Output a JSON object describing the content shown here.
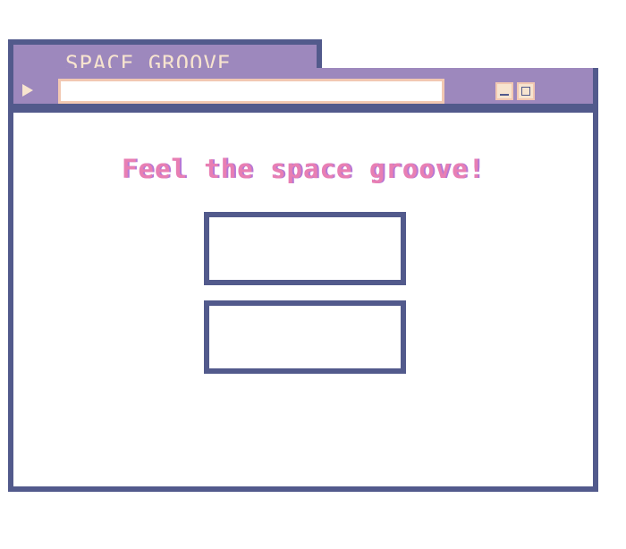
{
  "window": {
    "title": "SPACE GROOVE"
  },
  "toolbar": {
    "play_icon": "play-icon",
    "address_value": "",
    "minimize_icon": "minimize-icon",
    "maximize_icon": "maximize-icon"
  },
  "content": {
    "headline": "Feel the space groove!"
  },
  "colors": {
    "frame": "#525a8c",
    "title_bar": "#9d88bd",
    "title_text": "#f7e4cf",
    "accent_border": "#f2c8b2",
    "headline": "#e87fb3",
    "headline_shadow": "#b678d6"
  }
}
